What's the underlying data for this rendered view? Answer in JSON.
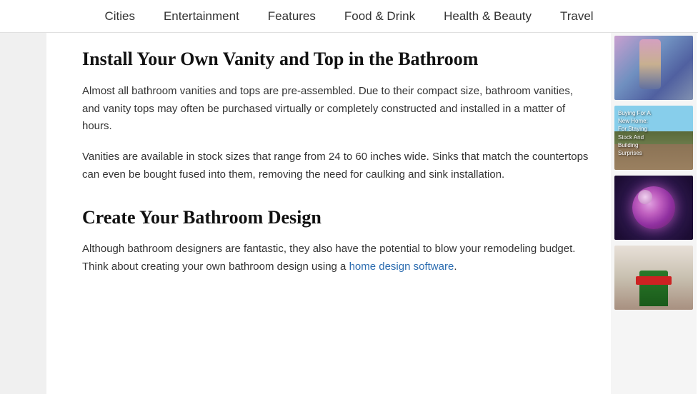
{
  "nav": {
    "items": [
      {
        "label": "Cities",
        "href": "#"
      },
      {
        "label": "Entertainment",
        "href": "#"
      },
      {
        "label": "Features",
        "href": "#"
      },
      {
        "label": "Food & Drink",
        "href": "#"
      },
      {
        "label": "Health & Beauty",
        "href": "#"
      },
      {
        "label": "Travel",
        "href": "#"
      }
    ]
  },
  "article": {
    "section1": {
      "heading": "Install Your Own Vanity and Top in the Bathroom",
      "paragraph1": "Almost all bathroom vanities and tops are pre-assembled. Due to their compact size, bathroom vanities, and vanity tops may often be purchased virtually or completely constructed and installed in a matter of hours.",
      "paragraph2": "Vanities are available in stock sizes that range from 24 to 60 inches wide. Sinks that match the countertops can even be bought fused into them, removing the need for caulking and sink installation."
    },
    "section2": {
      "heading": "Create Your Bathroom Design",
      "paragraph1_start": "Although bathroom designers are fantastic, they also have the potential to blow your remodeling budget. Think about creating your own bathroom design using a ",
      "link_text": "home design software",
      "paragraph1_end": "."
    }
  },
  "sidebar": {
    "images": [
      {
        "alt": "Fashion woman in jeans",
        "type": "fashion"
      },
      {
        "alt": "Home buying guide",
        "type": "house"
      },
      {
        "alt": "Virus bacteria illustration",
        "type": "virus"
      },
      {
        "alt": "Food delivery worker",
        "type": "delivery"
      }
    ]
  }
}
